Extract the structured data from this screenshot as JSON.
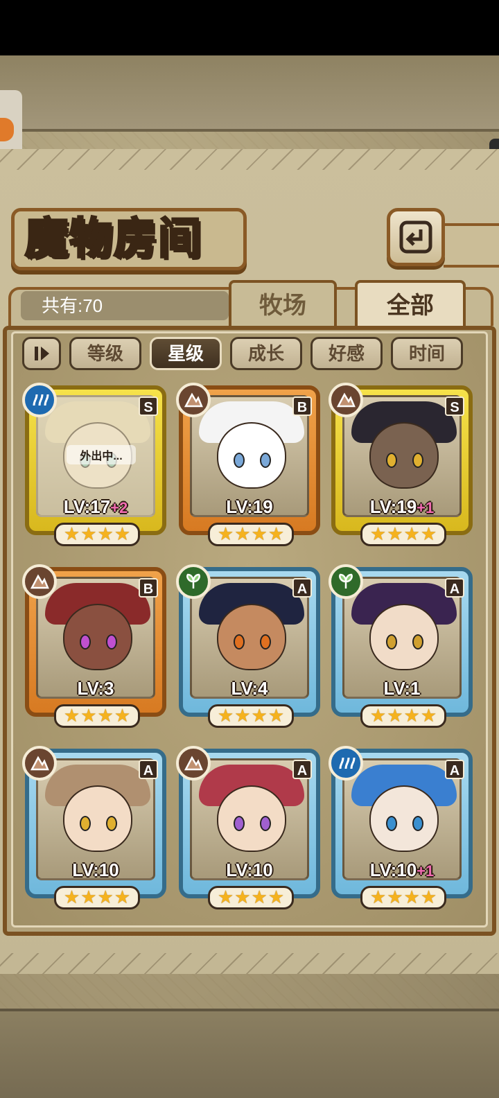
{
  "screen": {
    "title": "魔物房间",
    "count_label": "共有:70",
    "back_icon": "return-arrow-icon"
  },
  "tabs": [
    {
      "label": "牧场",
      "active": false
    },
    {
      "label": "全部",
      "active": true
    }
  ],
  "sort_buttons": [
    {
      "label": "等级",
      "active": false
    },
    {
      "label": "星级",
      "active": true
    },
    {
      "label": "成长",
      "active": false
    },
    {
      "label": "好感",
      "active": false
    },
    {
      "label": "时间",
      "active": false
    }
  ],
  "monsters": [
    {
      "rank": "S",
      "element": "water-icon",
      "frame": "gold",
      "level": "LV:17",
      "bonus": "+2",
      "stars": 4,
      "status": "外出中..."
    },
    {
      "rank": "B",
      "element": "earth-icon",
      "frame": "bronze",
      "level": "LV:19",
      "bonus": "",
      "stars": 4,
      "status": ""
    },
    {
      "rank": "S",
      "element": "earth-icon",
      "frame": "gold",
      "level": "LV:19",
      "bonus": "+1",
      "stars": 4,
      "status": ""
    },
    {
      "rank": "B",
      "element": "earth-icon",
      "frame": "bronze",
      "level": "LV:3",
      "bonus": "",
      "stars": 4,
      "status": ""
    },
    {
      "rank": "A",
      "element": "leaf-icon",
      "frame": "silver",
      "level": "LV:4",
      "bonus": "",
      "stars": 4,
      "status": ""
    },
    {
      "rank": "A",
      "element": "leaf-icon",
      "frame": "silver",
      "level": "LV:1",
      "bonus": "",
      "stars": 4,
      "status": ""
    },
    {
      "rank": "A",
      "element": "earth-icon",
      "frame": "silver",
      "level": "LV:10",
      "bonus": "",
      "stars": 4,
      "status": ""
    },
    {
      "rank": "A",
      "element": "earth-icon",
      "frame": "silver",
      "level": "LV:10",
      "bonus": "",
      "stars": 4,
      "status": ""
    },
    {
      "rank": "A",
      "element": "water-icon",
      "frame": "silver",
      "level": "LV:10",
      "bonus": "+1",
      "stars": 4,
      "status": ""
    }
  ],
  "colors": {
    "frame_brown": "#7b5222",
    "gold_frame": "#f6e24a",
    "bronze_frame": "#f0a24a",
    "silver_frame": "#a8d9ef",
    "star": "#f5b21e",
    "bonus": "#f06ab0"
  }
}
